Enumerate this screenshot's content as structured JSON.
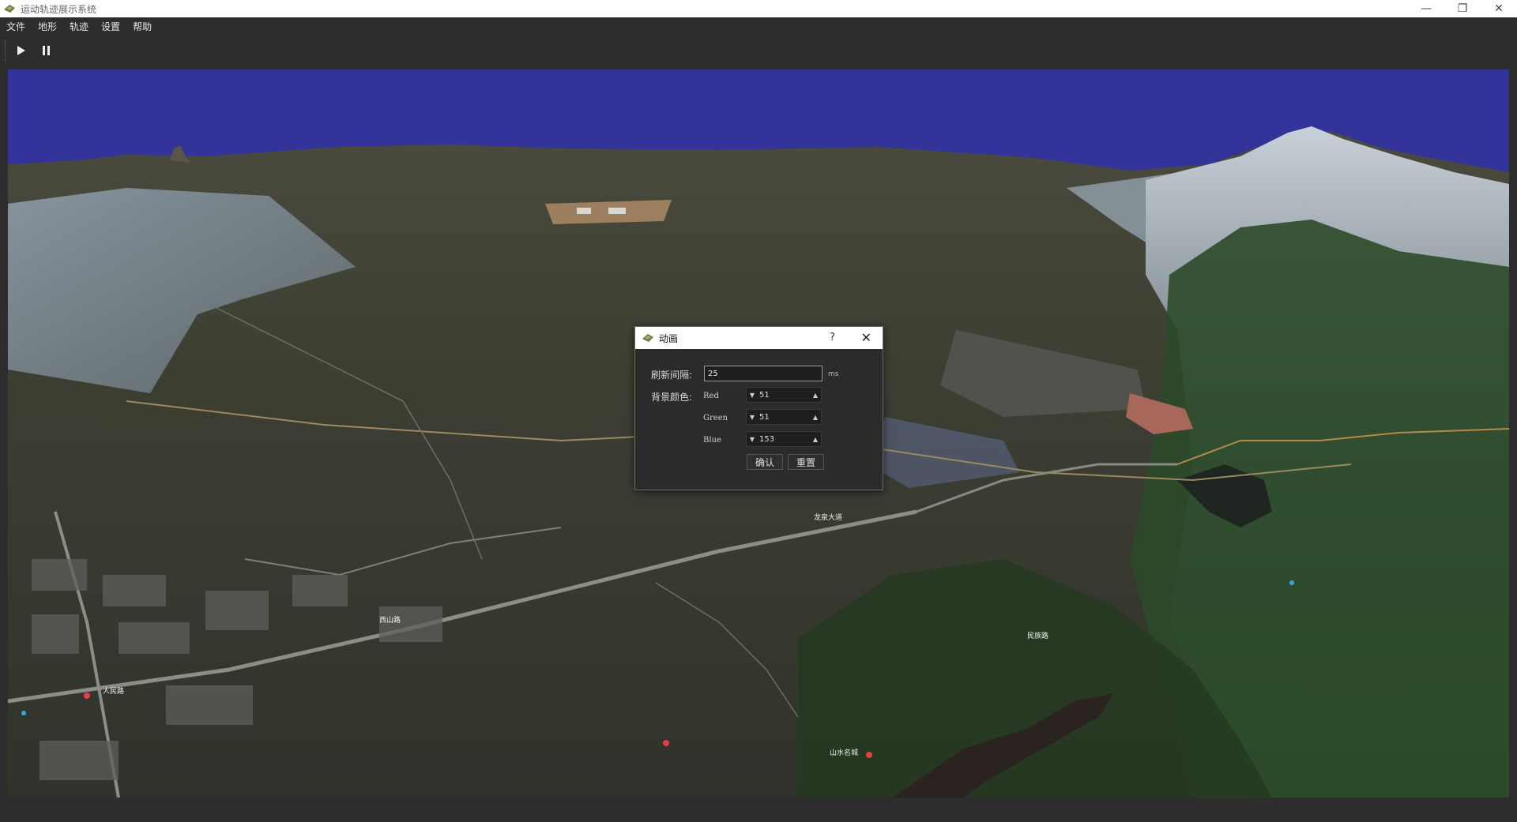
{
  "window": {
    "title": "运动轨迹展示系统",
    "controls": [
      "—",
      "❐",
      "✕"
    ]
  },
  "menu": [
    "文件",
    "地形",
    "轨迹",
    "设置",
    "帮助"
  ],
  "toolbar": {
    "play_icon": "play-icon",
    "pause_icon": "pause-icon"
  },
  "dialog": {
    "title": "动画",
    "help": "?",
    "close": "✕",
    "refresh_label": "刷新间隔:",
    "refresh_value": "25",
    "refresh_unit": "ms",
    "bg_label": "背景颜色:",
    "red_label": "Red",
    "red_value": "51",
    "green_label": "Green",
    "green_value": "51",
    "blue_label": "Blue",
    "blue_value": "153",
    "confirm": "确认",
    "reset": "重置"
  },
  "map_labels": [
    "人民路",
    "西山路",
    "龙泉大道",
    "山水名城",
    "民族路"
  ],
  "colors": {
    "sky": "#333399",
    "chrome": "#2d2d2d",
    "titlebar": "#ffffff"
  }
}
